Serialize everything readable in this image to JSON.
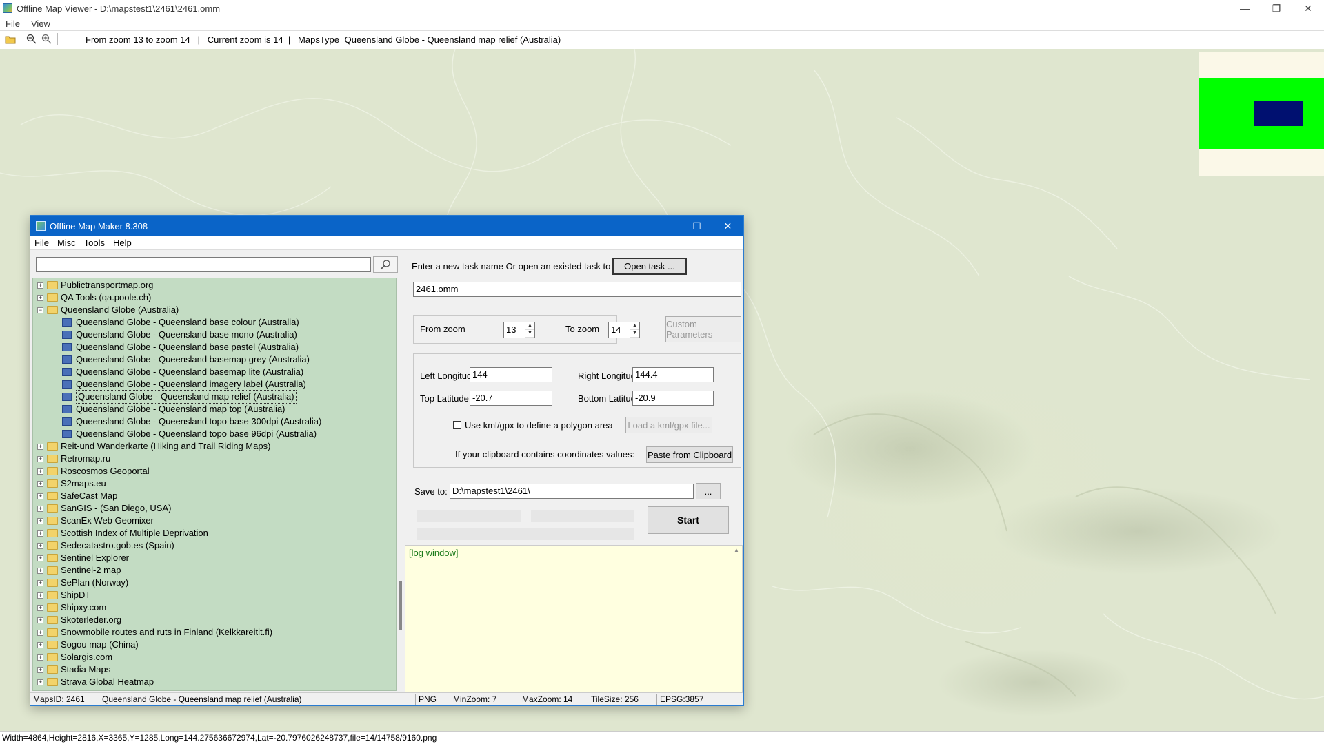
{
  "viewer": {
    "title": "Offline Map Viewer - D:\\mapstest1\\2461\\2461.omm",
    "menu": [
      "File",
      "View"
    ],
    "toolbar_status": "From zoom 13 to zoom 14   |   Current zoom is 14  |   MapsType=Queensland Globe - Queensland map relief (Australia)",
    "statusbar": "Width=4864,Height=2816,X=3365,Y=1285,Long=144.275636672974,Lat=-20.7976026248737,file=14/14758/9160.png",
    "window_buttons": {
      "minimize": "—",
      "restore": "❐",
      "close": "✕"
    }
  },
  "maker": {
    "title": "Offline Map Maker 8.308",
    "menu": [
      "File",
      "Misc",
      "Tools",
      "Help"
    ],
    "window_buttons": {
      "minimize": "—",
      "maximize": "☐",
      "close": "✕"
    },
    "search": {
      "value": "",
      "icon": "search-icon"
    },
    "tree": [
      {
        "label": "Publictransportmap.org",
        "type": "folder",
        "expanded": false
      },
      {
        "label": "QA Tools (qa.poole.ch)",
        "type": "folder",
        "expanded": false
      },
      {
        "label": "Queensland Globe (Australia)",
        "type": "folder",
        "expanded": true
      },
      {
        "label": "Queensland Globe - Queensland base colour (Australia)",
        "type": "map"
      },
      {
        "label": "Queensland Globe - Queensland base mono (Australia)",
        "type": "map"
      },
      {
        "label": "Queensland Globe - Queensland base pastel (Australia)",
        "type": "map"
      },
      {
        "label": "Queensland Globe - Queensland basemap grey (Australia)",
        "type": "map"
      },
      {
        "label": "Queensland Globe - Queensland basemap lite (Australia)",
        "type": "map"
      },
      {
        "label": "Queensland Globe - Queensland imagery label (Australia)",
        "type": "map"
      },
      {
        "label": "Queensland Globe - Queensland map relief (Australia)",
        "type": "map",
        "selected": true
      },
      {
        "label": "Queensland Globe - Queensland map top (Australia)",
        "type": "map"
      },
      {
        "label": "Queensland Globe - Queensland topo base 300dpi (Australia)",
        "type": "map"
      },
      {
        "label": "Queensland Globe - Queensland topo base 96dpi (Australia)",
        "type": "map"
      },
      {
        "label": "Reit-und Wanderkarte (Hiking and Trail Riding Maps)",
        "type": "folder",
        "expanded": false
      },
      {
        "label": "Retromap.ru",
        "type": "folder",
        "expanded": false
      },
      {
        "label": "Roscosmos Geoportal",
        "type": "folder",
        "expanded": false
      },
      {
        "label": "S2maps.eu",
        "type": "folder",
        "expanded": false
      },
      {
        "label": "SafeCast Map",
        "type": "folder",
        "expanded": false
      },
      {
        "label": "SanGIS - (San Diego, USA)",
        "type": "folder",
        "expanded": false
      },
      {
        "label": "ScanEx Web Geomixer",
        "type": "folder",
        "expanded": false
      },
      {
        "label": "Scottish Index of Multiple Deprivation",
        "type": "folder",
        "expanded": false
      },
      {
        "label": "Sedecatastro.gob.es (Spain)",
        "type": "folder",
        "expanded": false
      },
      {
        "label": "Sentinel Explorer",
        "type": "folder",
        "expanded": false
      },
      {
        "label": "Sentinel-2 map",
        "type": "folder",
        "expanded": false
      },
      {
        "label": "SePlan (Norway)",
        "type": "folder",
        "expanded": false
      },
      {
        "label": "ShipDT",
        "type": "folder",
        "expanded": false
      },
      {
        "label": "Shipxy.com",
        "type": "folder",
        "expanded": false
      },
      {
        "label": "Skoterleder.org",
        "type": "folder",
        "expanded": false
      },
      {
        "label": "Snowmobile routes and ruts in Finland (Kelkkareitit.fi)",
        "type": "folder",
        "expanded": false
      },
      {
        "label": "Sogou map (China)",
        "type": "folder",
        "expanded": false
      },
      {
        "label": "Solargis.com",
        "type": "folder",
        "expanded": false
      },
      {
        "label": "Stadia Maps",
        "type": "folder",
        "expanded": false
      },
      {
        "label": "Strava Global Heatmap",
        "type": "folder",
        "expanded": false
      }
    ],
    "task": {
      "prompt": "Enter a new task name Or open an existed task to continue:",
      "open_button": "Open task ...",
      "name": "2461.omm"
    },
    "zoom": {
      "from_label": "From zoom",
      "from_value": "13",
      "to_label": "To zoom",
      "to_value": "14",
      "custom_button": "Custom Parameters"
    },
    "coords": {
      "left_lon_label": "Left Longitude",
      "left_lon": "144",
      "right_lon_label": "Right Longitude",
      "right_lon": "144.4",
      "top_lat_label": "Top Latitude",
      "top_lat": "-20.7",
      "bottom_lat_label": "Bottom Latitude",
      "bottom_lat": "-20.9",
      "kml_label": "Use kml/gpx to define a polygon area",
      "kml_checked": false,
      "load_kml_button": "Load a kml/gpx file...",
      "clipboard_label": "If your clipboard contains coordinates values:",
      "paste_button": "Paste from Clipboard"
    },
    "save": {
      "label": "Save to:",
      "path": "D:\\mapstest1\\2461\\",
      "browse_button": "..."
    },
    "start_button": "Start",
    "log": "[log window]",
    "status": {
      "maps_id": "MapsID: 2461",
      "maps_name": "Queensland Globe - Queensland map relief (Australia)",
      "format": "PNG",
      "min_zoom": "MinZoom: 7",
      "max_zoom": "MaxZoom: 14",
      "tile_size": "TileSize: 256",
      "epsg": "EPSG:3857"
    }
  },
  "colors": {
    "map_bg": "#dfe6cf",
    "tree_bg": "#c3dcc3",
    "log_bg": "#ffffe0",
    "title_blue": "#0a64c8",
    "minimap_green": "#00ff00",
    "minimap_blue": "#001070"
  }
}
